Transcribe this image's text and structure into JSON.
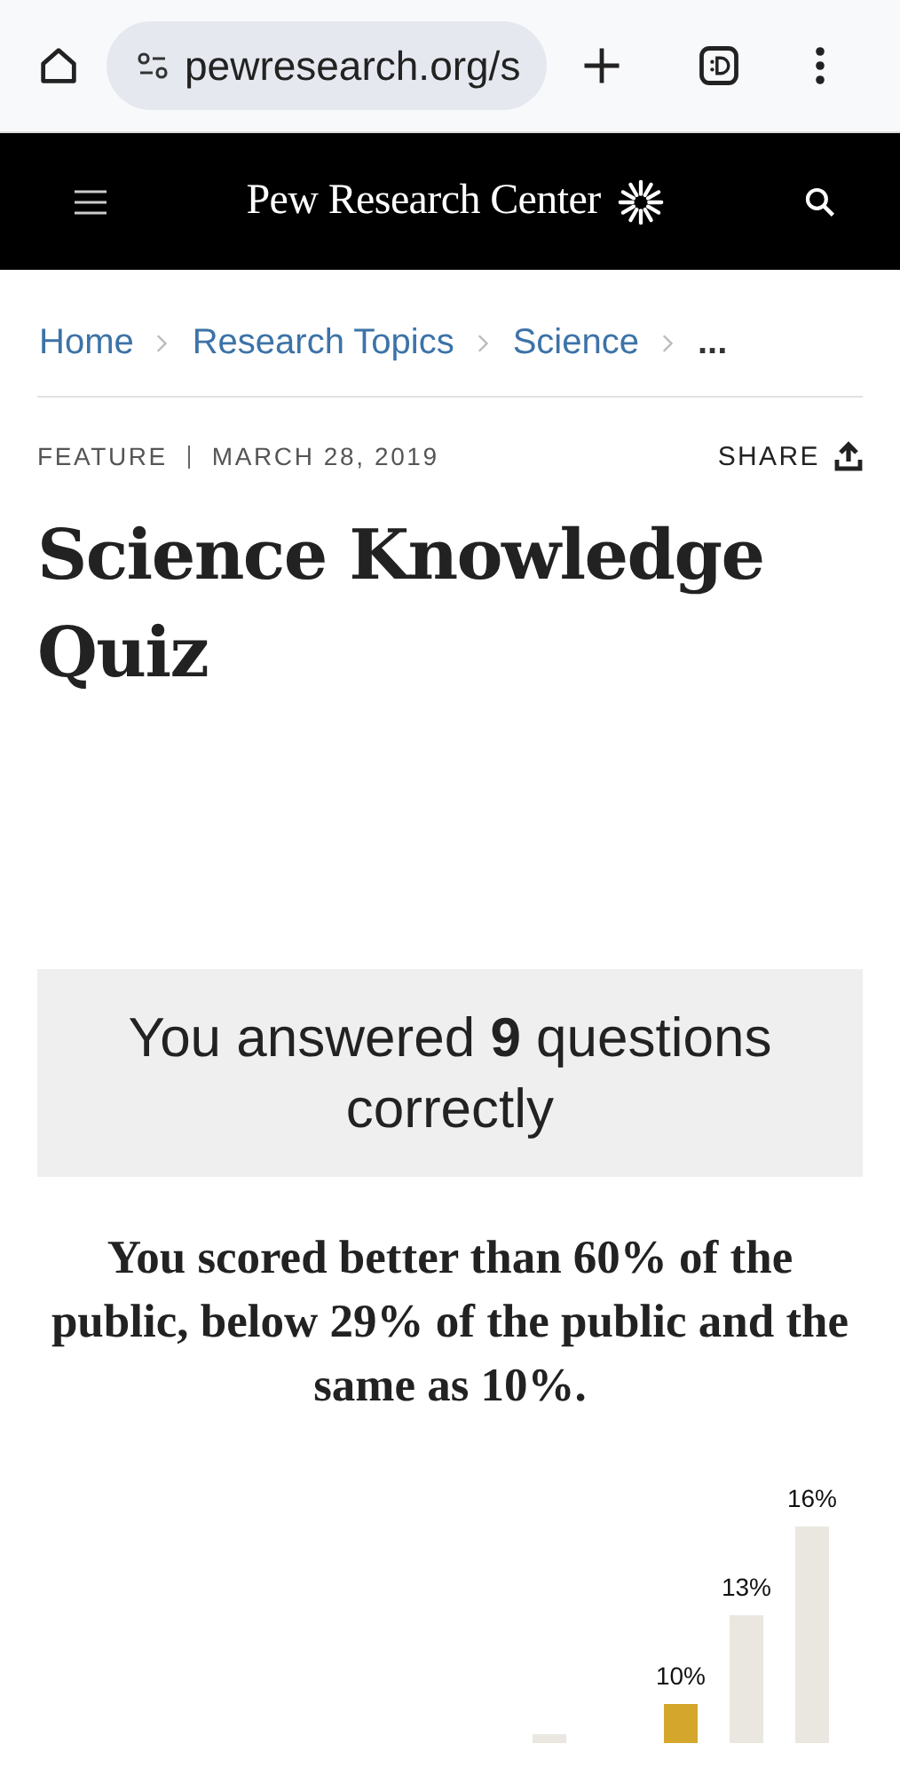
{
  "browser": {
    "url": "pewresearch.org/s"
  },
  "header": {
    "title": "Pew Research Center"
  },
  "breadcrumbs": [
    {
      "label": "Home",
      "kind": "link"
    },
    {
      "label": "Research Topics",
      "kind": "link"
    },
    {
      "label": "Science",
      "kind": "link"
    },
    {
      "label": "...",
      "kind": "more"
    }
  ],
  "meta": {
    "type": "FEATURE",
    "date": "MARCH 28, 2019",
    "share": "SHARE"
  },
  "title": "Science Knowledge Quiz",
  "result": "You answered **9** questions correctly",
  "summary": "You scored better than 60% of the public, below 29% of the public and the same as 10%.",
  "distribution": {
    "bars": [
      {
        "selected": false
      },
      {
        "selected": true,
        "label": "10%"
      },
      {
        "selected": false,
        "label": "13%"
      },
      {
        "selected": false,
        "label": "16%"
      }
    ]
  }
}
